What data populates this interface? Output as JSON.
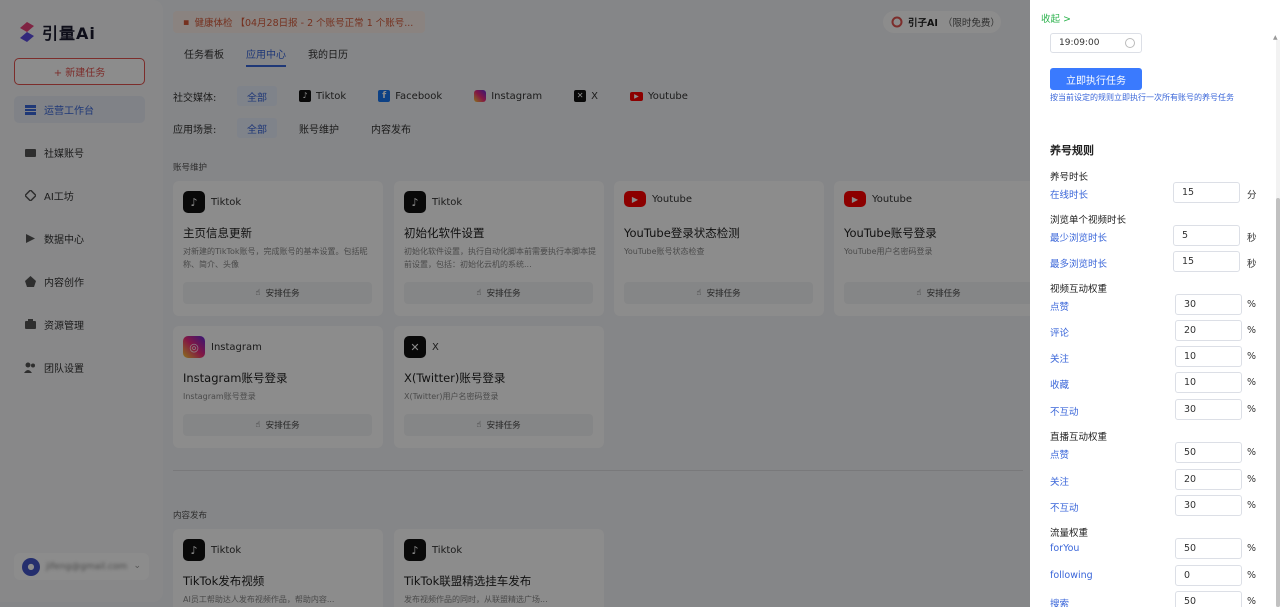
{
  "app": {
    "brand": "引量Ai"
  },
  "sidebar": {
    "new_task": "+ 新建任务",
    "items": [
      {
        "label": "运营工作台",
        "icon": "dashboard-icon",
        "active": true
      },
      {
        "label": "社媒账号",
        "icon": "social-account-icon",
        "active": false
      },
      {
        "label": "AI工坊",
        "icon": "ai-workshop-icon",
        "active": false
      },
      {
        "label": "数据中心",
        "icon": "data-center-icon",
        "active": false
      },
      {
        "label": "内容创作",
        "icon": "content-create-icon",
        "active": false
      },
      {
        "label": "资源管理",
        "icon": "resource-icon",
        "active": false
      },
      {
        "label": "团队设置",
        "icon": "team-icon",
        "active": false
      }
    ],
    "user_name": "jifeng@gmail.com"
  },
  "header": {
    "notice": "健康体检 【04月28日报 - 2 个账号正常 1 个账号...",
    "brand_pill": "引子AI",
    "brand_pill_free": "（限时免费）"
  },
  "tabs": [
    "任务看板",
    "应用中心",
    "我的日历"
  ],
  "filters": {
    "social_label": "社交媒体:",
    "social_options": [
      "全部",
      "Tiktok",
      "Facebook",
      "Instagram",
      "X",
      "Youtube"
    ],
    "scene_label": "应用场景:",
    "scene_options": [
      "全部",
      "账号维护",
      "内容发布"
    ]
  },
  "sections": {
    "maintain": "账号维护",
    "publish": "内容发布"
  },
  "schedule_label": "安排任务",
  "cards": [
    {
      "platform": "Tiktok",
      "title": "主页信息更新",
      "desc": "对新建的TikTok账号，完成账号的基本设置。包括昵称、简介、头像"
    },
    {
      "platform": "Tiktok",
      "title": "初始化软件设置",
      "desc": "初始化软件设置，执行自动化脚本前需要执行本脚本提前设置，包括：初始化云机的系统..."
    },
    {
      "platform": "Youtube",
      "title": "YouTube登录状态检测",
      "desc": "YouTube账号状态检查"
    },
    {
      "platform": "Youtube",
      "title": "YouTube账号登录",
      "desc": "YouTube用户名密码登录"
    },
    {
      "platform": "Instagram",
      "title": "Instagram账号登录",
      "desc": "Instagram账号登录"
    },
    {
      "platform": "X",
      "title": "X(Twitter)账号登录",
      "desc": "X(Twitter)用户名密码登录"
    },
    {
      "platform": "Tiktok",
      "title": "TikTok发布视频",
      "desc": "AI员工帮助达人发布视频作品，帮助内容..."
    },
    {
      "platform": "Tiktok",
      "title": "TikTok联盟精选挂车发布",
      "desc": "发布视频作品的同时，从联盟精选广场..."
    }
  ],
  "panel": {
    "collapse": "收起 >",
    "time_value": "19:09:00",
    "run_button": "立即执行任务",
    "run_desc": "按当前设定的规则立即执行一次所有账号的养号任务",
    "rules_title": "养号规则",
    "groups": {
      "duration": "养号时长",
      "browse": "浏览单个视频时长",
      "video_weight": "视频互动权重",
      "live_weight": "直播互动权重",
      "traffic_weight": "流量权重"
    },
    "rows": {
      "online": {
        "label": "在线时长",
        "value": "15",
        "unit": "分"
      },
      "min_browse": {
        "label": "最少浏览时长",
        "value": "5",
        "unit": "秒"
      },
      "max_browse": {
        "label": "最多浏览时长",
        "value": "15",
        "unit": "秒"
      },
      "v_like": {
        "label": "点赞",
        "value": "30",
        "unit": "%"
      },
      "v_comment": {
        "label": "评论",
        "value": "20",
        "unit": "%"
      },
      "v_follow": {
        "label": "关注",
        "value": "10",
        "unit": "%"
      },
      "v_fav": {
        "label": "收藏",
        "value": "10",
        "unit": "%"
      },
      "v_none": {
        "label": "不互动",
        "value": "30",
        "unit": "%"
      },
      "l_like": {
        "label": "点赞",
        "value": "50",
        "unit": "%"
      },
      "l_follow": {
        "label": "关注",
        "value": "20",
        "unit": "%"
      },
      "l_none": {
        "label": "不互动",
        "value": "30",
        "unit": "%"
      },
      "t_foryou": {
        "label": "forYou",
        "value": "50",
        "unit": "%"
      },
      "t_following": {
        "label": "following",
        "value": "0",
        "unit": "%"
      },
      "t_search": {
        "label": "搜索",
        "value": "50",
        "unit": "%"
      }
    }
  },
  "colors": {
    "accent": "#3a66d9",
    "danger": "#e2534f",
    "success": "#2bb24c",
    "primary_button": "#3a7afe"
  }
}
